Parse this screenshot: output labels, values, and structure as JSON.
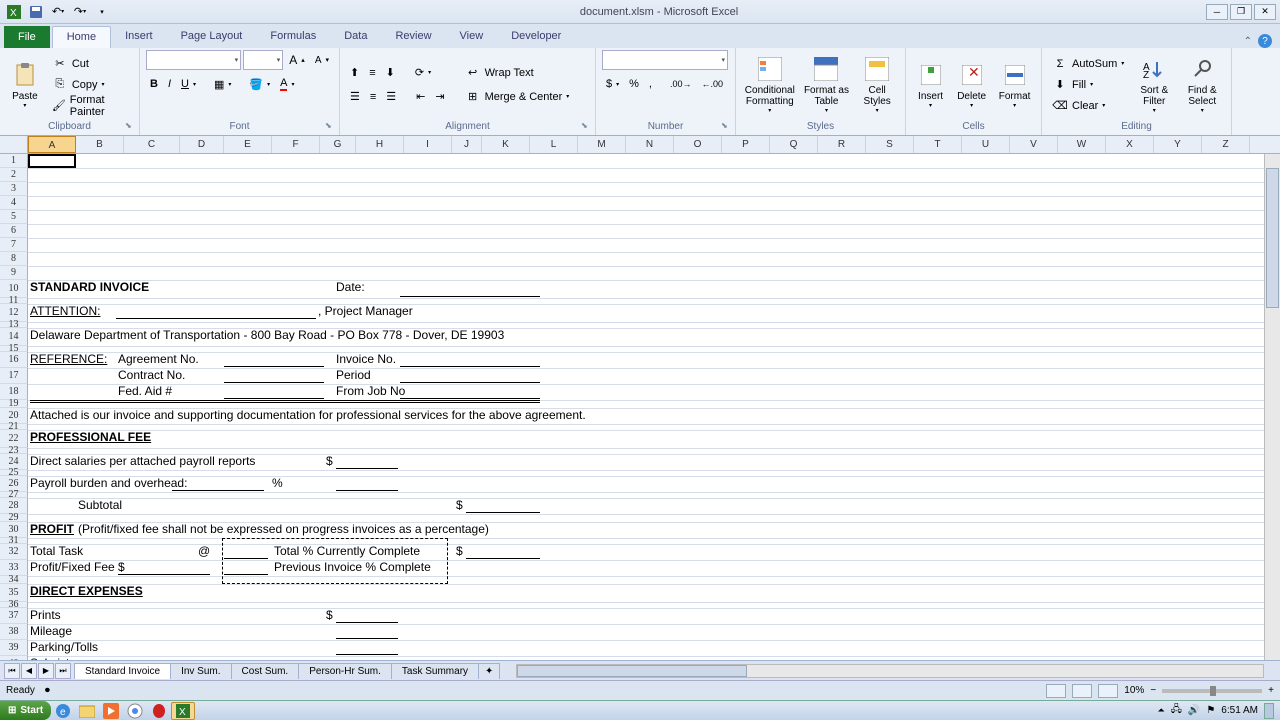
{
  "title": "document.xlsm - Microsoft Excel",
  "tabs": {
    "file": "File",
    "home": "Home",
    "insert": "Insert",
    "pagelayout": "Page Layout",
    "formulas": "Formulas",
    "data": "Data",
    "review": "Review",
    "view": "View",
    "developer": "Developer"
  },
  "clipboard": {
    "label": "Clipboard",
    "paste": "Paste",
    "cut": "Cut",
    "copy": "Copy",
    "format_painter": "Format Painter"
  },
  "font": {
    "label": "Font",
    "name": "",
    "size": ""
  },
  "alignment": {
    "label": "Alignment",
    "wrap": "Wrap Text",
    "merge": "Merge & Center"
  },
  "number": {
    "label": "Number",
    "format": ""
  },
  "styles": {
    "label": "Styles",
    "cond": "Conditional Formatting",
    "table": "Format as Table",
    "cell": "Cell Styles"
  },
  "cells": {
    "label": "Cells",
    "insert": "Insert",
    "delete": "Delete",
    "format": "Format"
  },
  "editing": {
    "label": "Editing",
    "autosum": "AutoSum",
    "fill": "Fill",
    "clear": "Clear",
    "sort": "Sort & Filter",
    "find": "Find & Select"
  },
  "columns": [
    "A",
    "B",
    "C",
    "D",
    "E",
    "F",
    "G",
    "H",
    "I",
    "J",
    "K",
    "L",
    "M",
    "N",
    "O",
    "P",
    "Q",
    "R",
    "S",
    "T",
    "U",
    "V",
    "W",
    "X",
    "Y",
    "Z"
  ],
  "doc": {
    "r10": "STANDARD INVOICE",
    "r10_date": "Date:",
    "r12_att": "ATTENTION:",
    "r12_pm": ", Project Manager",
    "r14": "Delaware Department of Transportation - 800 Bay Road - PO Box 778 - Dover, DE 19903",
    "r16_ref": "REFERENCE:",
    "r16_agr": "Agreement No.",
    "r16_inv": "Invoice No.",
    "r17_con": "Contract No.",
    "r17_per": "Period",
    "r18_fed": "Fed. Aid #",
    "r18_job": "From Job No",
    "r20": "Attached is our invoice and supporting documentation for professional services for the above agreement.",
    "r22": "PROFESSIONAL FEE",
    "r24": "Direct salaries per attached payroll reports",
    "r24_s": "$",
    "r26": "Payroll burden and overhead:",
    "r26_p": "%",
    "r28": "Subtotal",
    "r28_s": "$",
    "r30_a": "PROFIT",
    "r30_b": "(Profit/fixed fee shall not be expressed on progress invoices as a percentage)",
    "r32_a": "Total Task",
    "r32_at": "@",
    "r32_b": "Total % Currently Complete",
    "r32_s": "$",
    "r33_a": "Profit/Fixed Fee $",
    "r33_b": "Previous Invoice % Complete",
    "r35": "DIRECT EXPENSES",
    "r37": "Prints",
    "r37_s": "$",
    "r38": "Mileage",
    "r39": "Parking/Tolls",
    "r40": "Subsistence"
  },
  "sheets": [
    "Standard Invoice",
    "Inv Sum.",
    "Cost Sum.",
    "Person-Hr Sum.",
    "Task Summary"
  ],
  "status": {
    "ready": "Ready",
    "zoom": "10%"
  },
  "taskbar": {
    "start": "Start",
    "time": "6:51 AM"
  }
}
